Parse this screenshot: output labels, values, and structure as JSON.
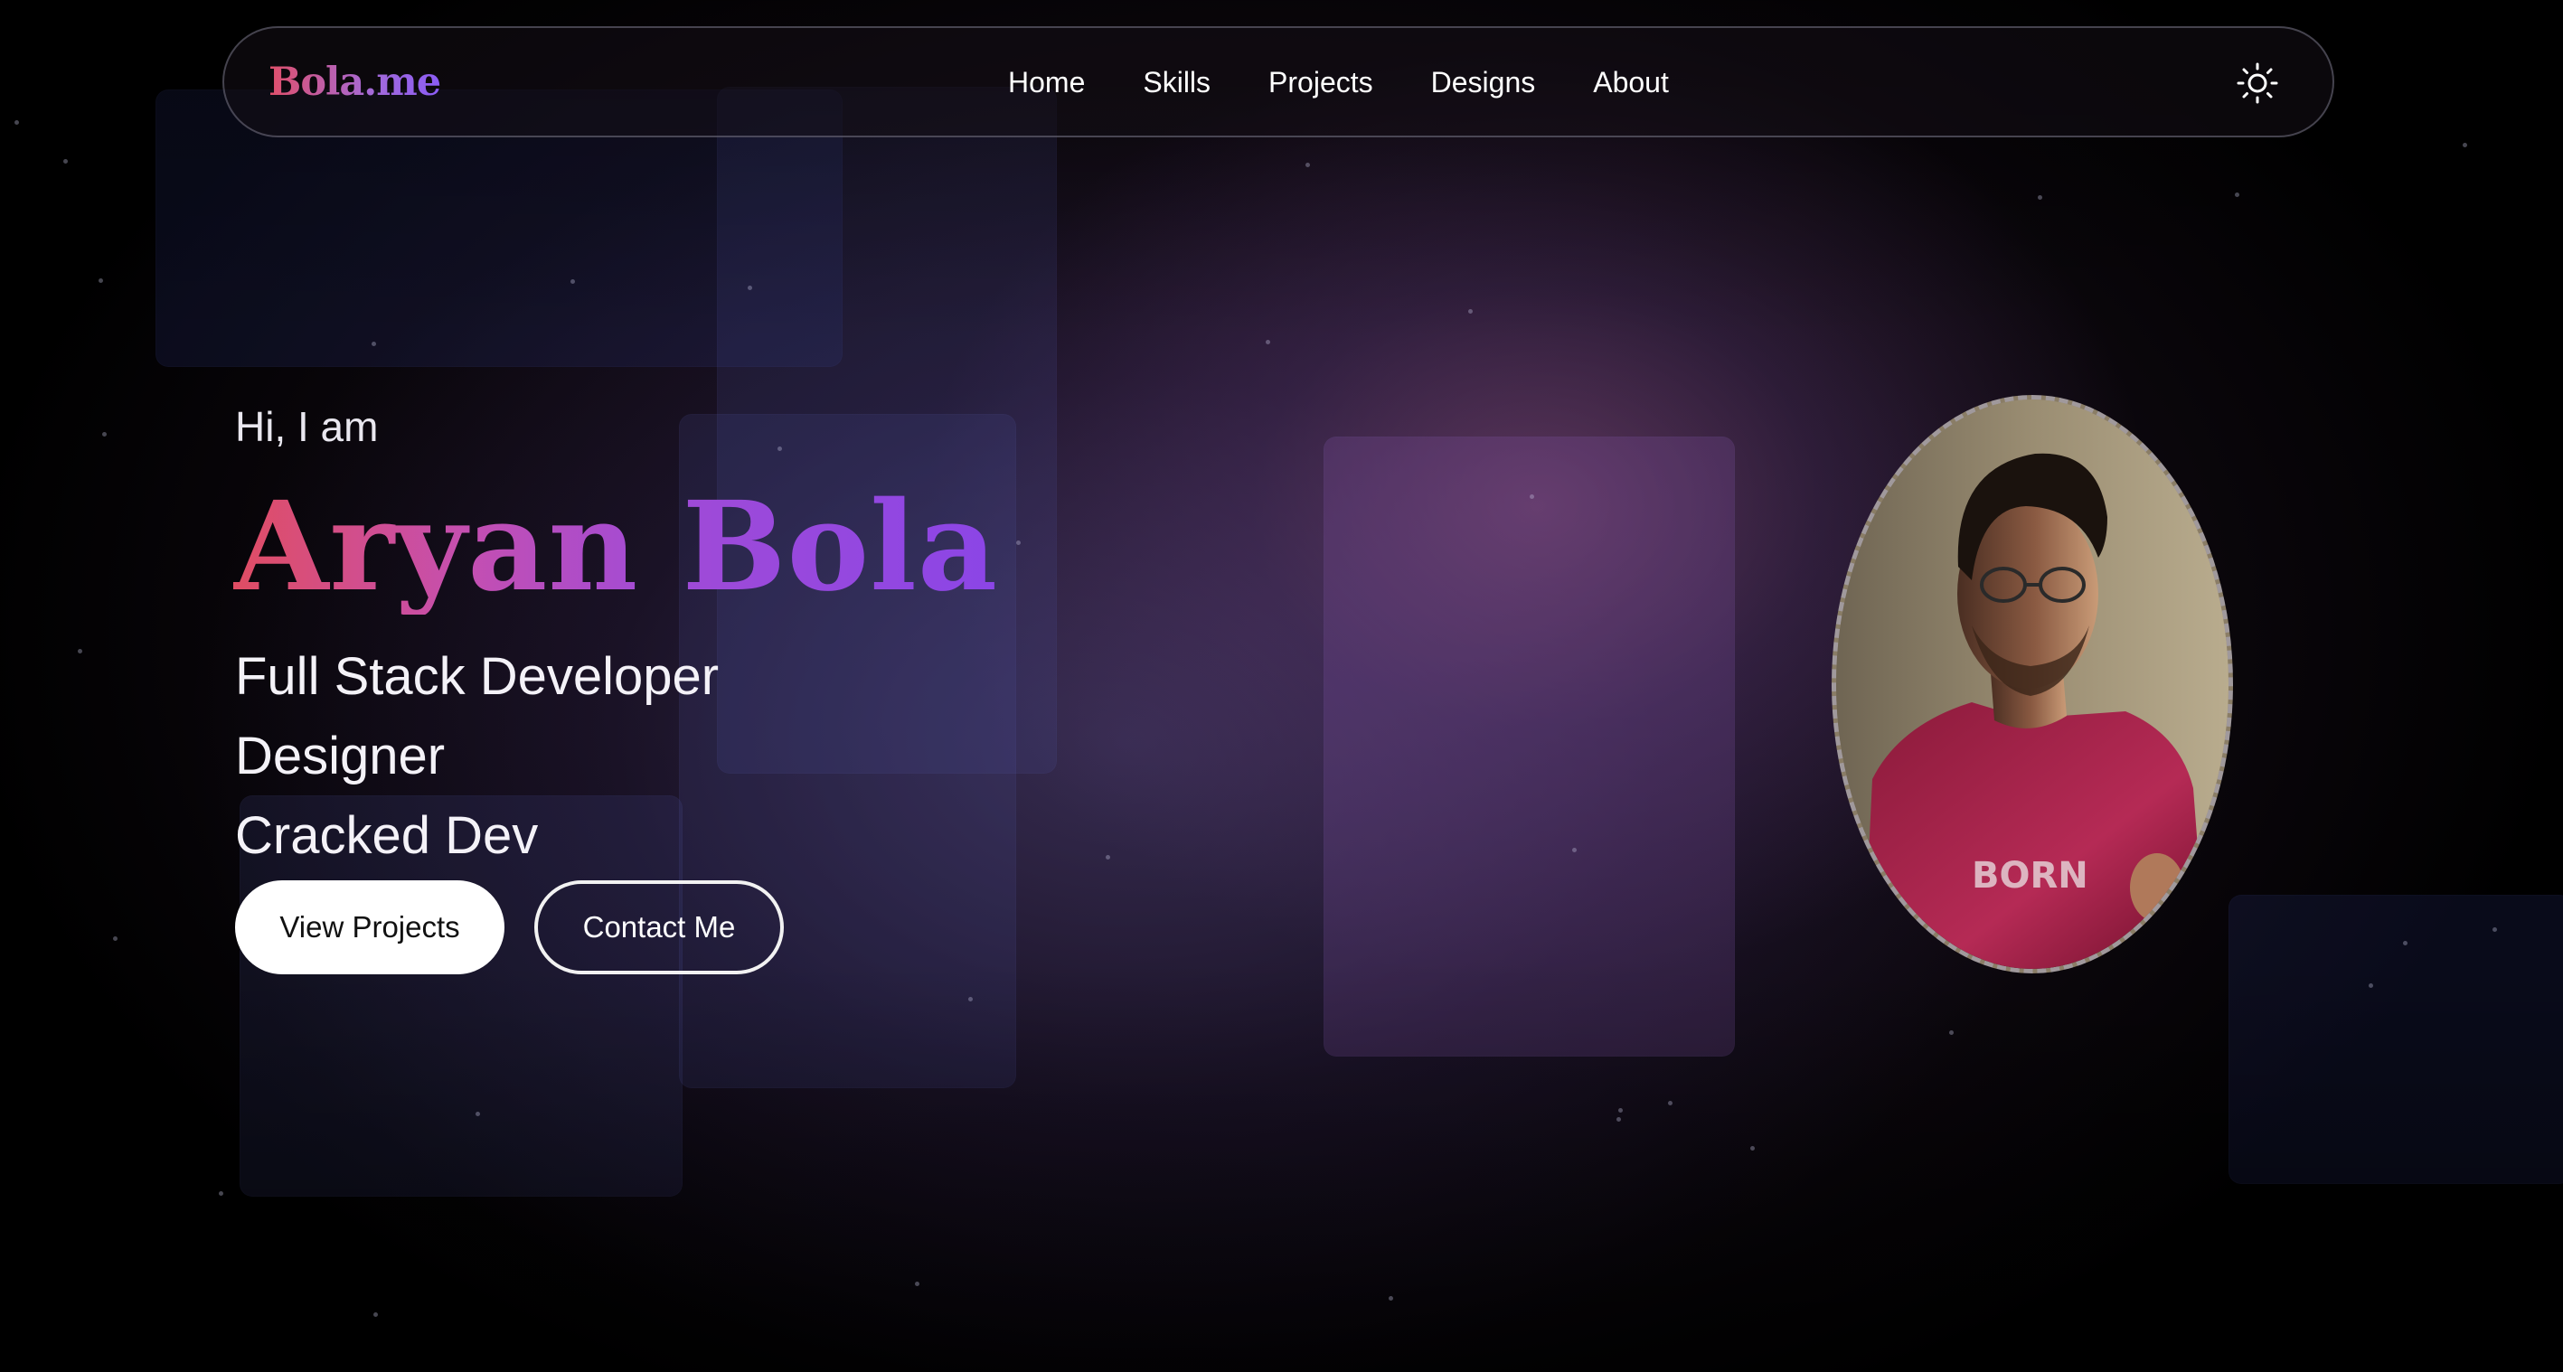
{
  "site": {
    "logo": "Bola.me"
  },
  "nav": {
    "items": [
      {
        "label": "Home"
      },
      {
        "label": "Skills"
      },
      {
        "label": "Projects"
      },
      {
        "label": "Designs"
      },
      {
        "label": "About"
      }
    ],
    "theme_toggle_icon": "sun-icon"
  },
  "hero": {
    "greeting": "Hi, I am",
    "name": "Aryan Bola",
    "roles": [
      "Full Stack Developer",
      "Designer",
      "Cracked Dev"
    ],
    "primary_button": "View Projects",
    "secondary_button": "Contact Me",
    "avatar_icon": "profile-photo",
    "shirt_text": "BORN"
  },
  "colors": {
    "accent_start": "#e04d63",
    "accent_end": "#8b45e6",
    "background": "#000000"
  }
}
